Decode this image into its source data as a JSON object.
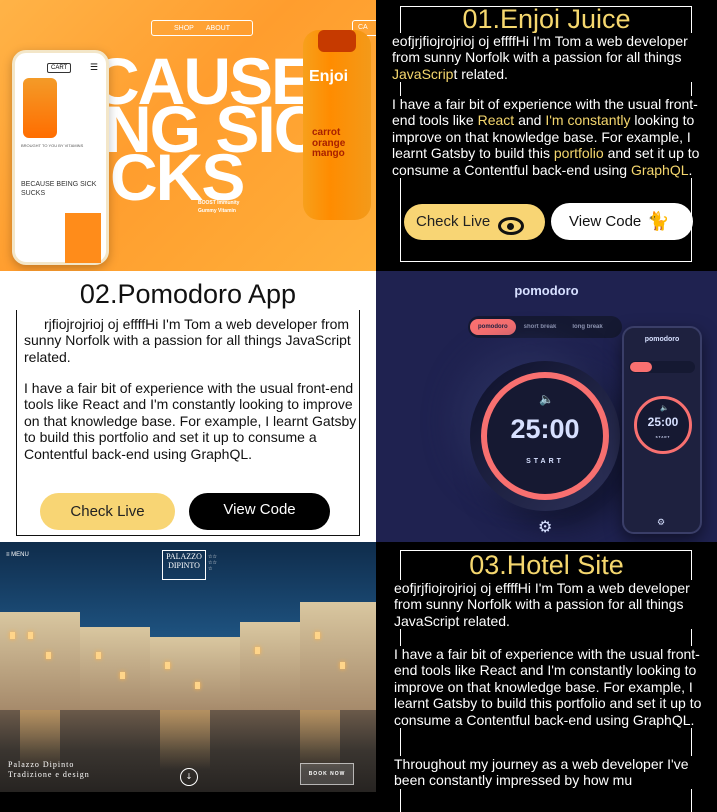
{
  "projects": [
    {
      "title": "01.Enjoi Juice",
      "para1_pre": "eofjrjfiojrojrioj oj effffHi I'm Tom a web developer from sunny Norfolk with a passion for all things ",
      "para1_hl": "JavaScrip",
      "para1_post": "t related.",
      "para2_a": "I have a fair bit of experience with the usual front-end tools like ",
      "para2_react": "React",
      "para2_and": " and ",
      "para2_hl2": "I'm constantly",
      "para2_b": " looking to improve on that knowledge base. For example, I learnt Gatsby to build this ",
      "para2_portfolio": "portfolio",
      "para2_c": " and set it up to consume a Contentful back-end using ",
      "para2_graphql": "GraphQL",
      "para2_end": ".",
      "check_live": "Check Live",
      "view_code": "View Code"
    },
    {
      "title": "02.Pomodoro App",
      "para1": "rjfiojrojrioj oj effffHi I'm Tom a web developer from sunny Norfolk with a passion for all things JavaScript related.",
      "para2": "I have a fair bit of experience with the usual front-end tools like React and I'm constantly looking to improve on that knowledge base. For example, I learnt Gatsby to build this portfolio and set it up to consume a Contentful back-end using GraphQL.",
      "check_live": "Check Live",
      "view_code": "View Code"
    },
    {
      "title": "03.Hotel Site",
      "para1": "eofjrjfiojrojrioj oj effffHi I'm Tom a web developer from sunny Norfolk with a passion for all things JavaScript related.",
      "para2": "I have a fair bit of experience with the usual front-end tools like React and I'm constantly looking to improve on that knowledge base. For example, I learnt Gatsby to build this portfolio and set it up to consume a Contentful back-end using GraphQL.",
      "para3": "Throughout my journey as a web developer I've been constantly impressed by how mu"
    }
  ],
  "juice_preview": {
    "nav_shop": "SHOP",
    "nav_about": "ABOUT",
    "nav_right": "CA",
    "big1": "CAUSE",
    "big2": "NG SICK",
    "big3": "CKS",
    "cart": "CART",
    "phone_heading": "BECAUSE BEING SICK SUCKS",
    "phone_sub": "BROUGHT TO YOU BY VITAMINS",
    "bottle_brand": "Enjoi",
    "bottle_flavor": "carrot orange mango",
    "boost_line1": "BOOST Immunity",
    "boost_line2": "Gummy Vitamin"
  },
  "pomodoro_preview": {
    "title": "pomodoro",
    "tabs": [
      "pomodoro",
      "short break",
      "long break"
    ],
    "time": "25:00",
    "start": "START",
    "phone_title": "pomodoro",
    "phone_time": "25:00",
    "phone_start": "START"
  },
  "hotel_preview": {
    "menu": "≡ MENU",
    "brand": "PALAZZO DIPINTO",
    "name_line1": "Palazzo Dipinto",
    "name_line2": "Tradizione e design",
    "book_now": "BOOK NOW"
  },
  "colors": {
    "accent_yellow": "#f8d574",
    "pomodoro_red": "#f87070",
    "pomodoro_bg": "#1f2250"
  }
}
